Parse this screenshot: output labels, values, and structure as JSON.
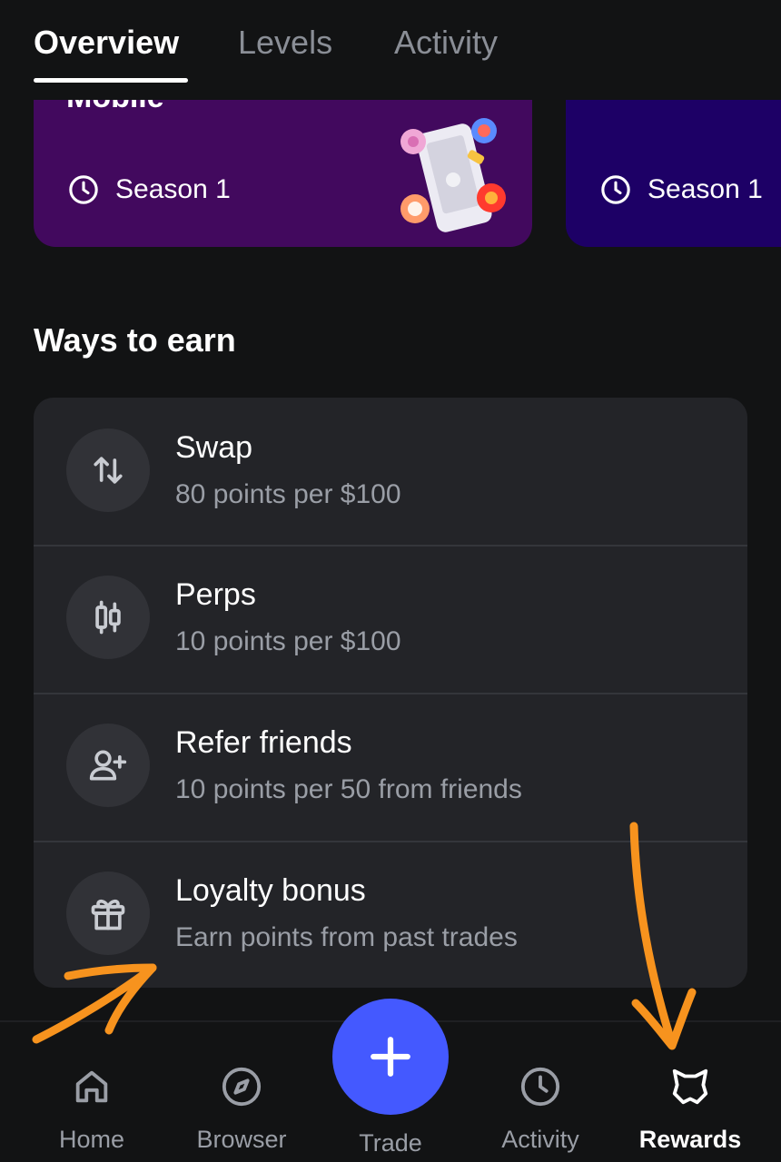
{
  "tabs": [
    {
      "label": "Overview",
      "active": true
    },
    {
      "label": "Levels",
      "active": false
    },
    {
      "label": "Activity",
      "active": false
    }
  ],
  "season_cards": [
    {
      "title_partial": "Mobile",
      "season": "Season 1",
      "color": "#42095e",
      "icon": "clock-icon"
    },
    {
      "season": "Season 1",
      "color": "#1d0066",
      "icon": "clock-icon"
    }
  ],
  "ways_to_earn": {
    "title": "Ways to earn",
    "items": [
      {
        "title": "Swap",
        "subtitle": "80 points per $100",
        "icon": "swap-arrows-icon"
      },
      {
        "title": "Perps",
        "subtitle": "10 points per $100",
        "icon": "candlestick-icon"
      },
      {
        "title": "Refer friends",
        "subtitle": "10 points per 50 from friends",
        "icon": "add-user-icon"
      },
      {
        "title": "Loyalty bonus",
        "subtitle": "Earn points from past trades",
        "icon": "gift-icon"
      }
    ]
  },
  "bottom_nav": {
    "items": [
      {
        "label": "Home",
        "icon": "home-icon",
        "active": false
      },
      {
        "label": "Browser",
        "icon": "compass-icon",
        "active": false
      },
      {
        "label": "Trade",
        "icon": "plus-icon",
        "active": false
      },
      {
        "label": "Activity",
        "icon": "clock-icon",
        "active": false
      },
      {
        "label": "Rewards",
        "icon": "fox-icon",
        "active": true
      }
    ]
  },
  "colors": {
    "background": "#121314",
    "list_background": "#232428",
    "accent": "#4459ff",
    "annotation": "#f7931e"
  }
}
